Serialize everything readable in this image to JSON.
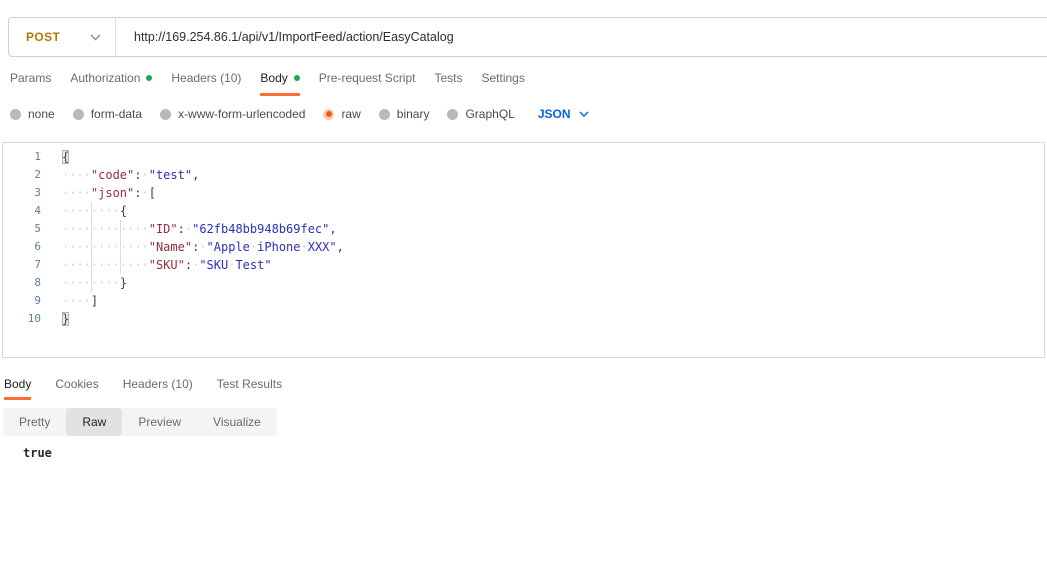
{
  "request": {
    "method": "POST",
    "url": "http://169.254.86.1/api/v1/ImportFeed/action/EasyCatalog",
    "tabs": [
      {
        "label": "Params",
        "dot": false,
        "active": false
      },
      {
        "label": "Authorization",
        "dot": true,
        "active": false
      },
      {
        "label": "Headers (10)",
        "dot": false,
        "active": false
      },
      {
        "label": "Body",
        "dot": true,
        "active": true
      },
      {
        "label": "Pre-request Script",
        "dot": false,
        "active": false
      },
      {
        "label": "Tests",
        "dot": false,
        "active": false
      },
      {
        "label": "Settings",
        "dot": false,
        "active": false
      }
    ],
    "body_types": [
      {
        "label": "none",
        "selected": false
      },
      {
        "label": "form-data",
        "selected": false
      },
      {
        "label": "x-www-form-urlencoded",
        "selected": false
      },
      {
        "label": "raw",
        "selected": true
      },
      {
        "label": "binary",
        "selected": false
      },
      {
        "label": "GraphQL",
        "selected": false
      }
    ],
    "language": "JSON"
  },
  "editor": {
    "lines": [
      {
        "num": "1",
        "segments": [
          {
            "c": "brh",
            "t": "{"
          }
        ]
      },
      {
        "num": "2",
        "segments": [
          {
            "c": "ws",
            "t": "····"
          },
          {
            "c": "key",
            "t": "\"code\""
          },
          {
            "c": "pun",
            "t": ":"
          },
          {
            "c": "ws",
            "t": "·"
          },
          {
            "c": "str",
            "t": "\"test\""
          },
          {
            "c": "pun",
            "t": ","
          }
        ]
      },
      {
        "num": "3",
        "segments": [
          {
            "c": "ws",
            "t": "····"
          },
          {
            "c": "key",
            "t": "\"json\""
          },
          {
            "c": "pun",
            "t": ":"
          },
          {
            "c": "ws",
            "t": "·"
          },
          {
            "c": "pun",
            "t": "["
          }
        ]
      },
      {
        "num": "4",
        "segments": [
          {
            "c": "ws",
            "t": "····"
          },
          {
            "c": "gd"
          },
          {
            "c": "ws",
            "t": "····"
          },
          {
            "c": "pun",
            "t": "{"
          }
        ]
      },
      {
        "num": "5",
        "segments": [
          {
            "c": "ws",
            "t": "····"
          },
          {
            "c": "gd"
          },
          {
            "c": "ws",
            "t": "····"
          },
          {
            "c": "gd"
          },
          {
            "c": "ws",
            "t": "····"
          },
          {
            "c": "key",
            "t": "\"ID\""
          },
          {
            "c": "pun",
            "t": ":"
          },
          {
            "c": "ws",
            "t": "·"
          },
          {
            "c": "str",
            "t": "\"62fb48bb948b69fec\""
          },
          {
            "c": "pun",
            "t": ","
          }
        ]
      },
      {
        "num": "6",
        "segments": [
          {
            "c": "ws",
            "t": "····"
          },
          {
            "c": "gd"
          },
          {
            "c": "ws",
            "t": "····"
          },
          {
            "c": "gd"
          },
          {
            "c": "ws",
            "t": "····"
          },
          {
            "c": "key",
            "t": "\"Name\""
          },
          {
            "c": "pun",
            "t": ":"
          },
          {
            "c": "ws",
            "t": "·"
          },
          {
            "c": "str",
            "t": "\"Apple"
          },
          {
            "c": "ws",
            "t": "·"
          },
          {
            "c": "str",
            "t": "iPhone"
          },
          {
            "c": "ws",
            "t": "·"
          },
          {
            "c": "str",
            "t": "XXX\""
          },
          {
            "c": "pun",
            "t": ","
          }
        ]
      },
      {
        "num": "7",
        "segments": [
          {
            "c": "ws",
            "t": "····"
          },
          {
            "c": "gd"
          },
          {
            "c": "ws",
            "t": "····"
          },
          {
            "c": "gd"
          },
          {
            "c": "ws",
            "t": "····"
          },
          {
            "c": "key",
            "t": "\"SKU\""
          },
          {
            "c": "pun",
            "t": ":"
          },
          {
            "c": "ws",
            "t": "·"
          },
          {
            "c": "str",
            "t": "\"SKU"
          },
          {
            "c": "ws",
            "t": "·"
          },
          {
            "c": "str",
            "t": "Test\""
          }
        ]
      },
      {
        "num": "8",
        "segments": [
          {
            "c": "ws",
            "t": "····"
          },
          {
            "c": "gd"
          },
          {
            "c": "ws",
            "t": "····"
          },
          {
            "c": "pun",
            "t": "}"
          }
        ]
      },
      {
        "num": "9",
        "segments": [
          {
            "c": "ws",
            "t": "····"
          },
          {
            "c": "pun",
            "t": "]"
          }
        ]
      },
      {
        "num": "10",
        "segments": [
          {
            "c": "brh",
            "t": "}"
          }
        ]
      }
    ]
  },
  "response": {
    "tabs": [
      {
        "label": "Body",
        "active": true
      },
      {
        "label": "Cookies",
        "active": false
      },
      {
        "label": "Headers (10)",
        "active": false
      },
      {
        "label": "Test Results",
        "active": false
      }
    ],
    "views": [
      {
        "label": "Pretty",
        "selected": false
      },
      {
        "label": "Raw",
        "selected": true
      },
      {
        "label": "Preview",
        "selected": false
      },
      {
        "label": "Visualize",
        "selected": false
      }
    ],
    "body": "true"
  },
  "icons": {
    "method_chevron": "chevron-down",
    "language_chevron": "chevron-down"
  },
  "colors": {
    "accent_orange": "#ff6c37",
    "status_green": "#24a550",
    "method_post": "#ae7a03",
    "language_blue": "#0265d2",
    "json_key": "#9b2c3c",
    "json_string": "#2b2fbe"
  }
}
